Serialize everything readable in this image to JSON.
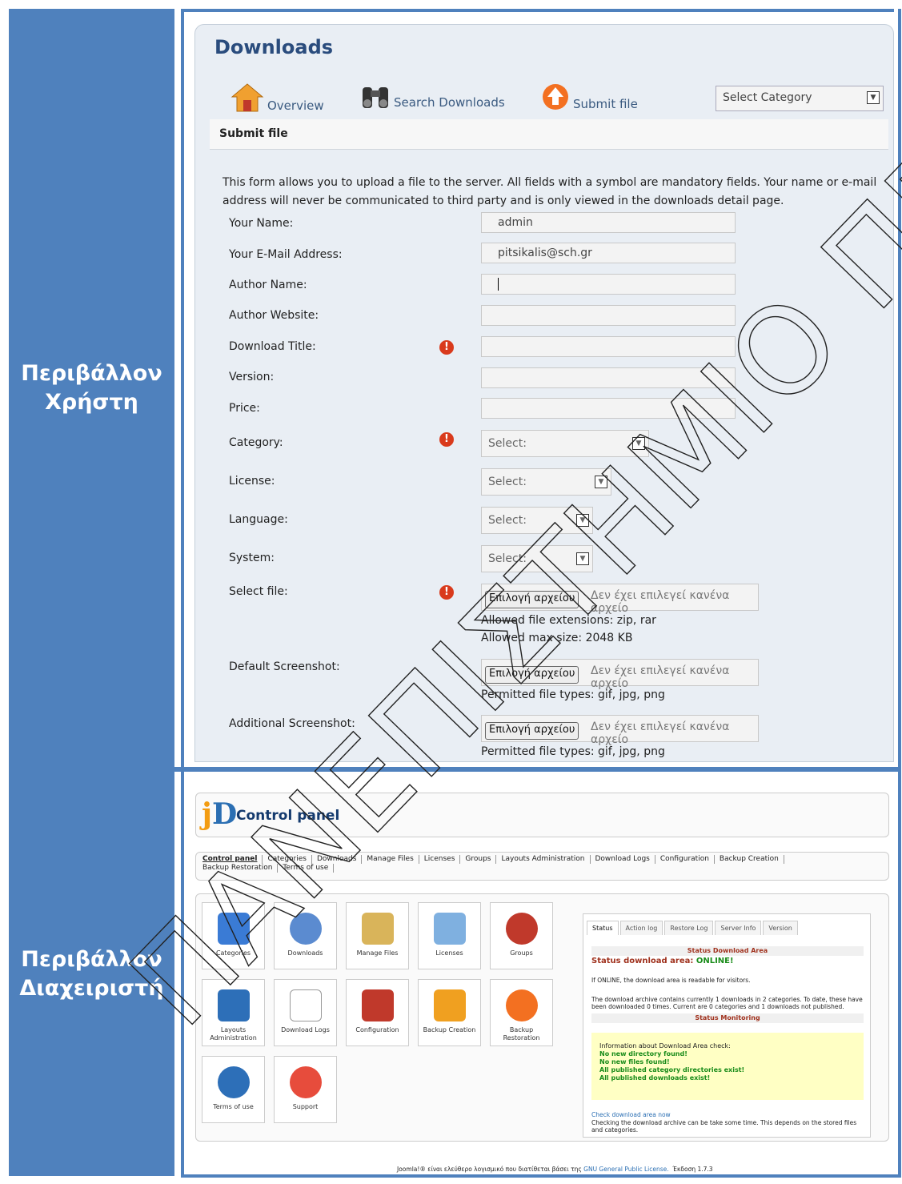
{
  "labels": {
    "user": "Περιβάλλον Χρήστη",
    "user_l1": "Περιβάλλον",
    "user_l2": "Χρήστη",
    "admin_l1": "Περιβάλλον",
    "admin_l2": "Διαχειριστή"
  },
  "user": {
    "title": "Downloads",
    "nav": {
      "overview": "Overview",
      "search": "Search Downloads",
      "submit": "Submit file"
    },
    "category_select": "Select Category",
    "subbar": "Submit file",
    "intro": "This form allows you to upload a file to the server. All fields with a symbol are mandatory fields. Your name or e-mail address will never be communicated to third party and is only viewed in the downloads detail page.",
    "fields": {
      "name_label": "Your Name:",
      "name_value": "admin",
      "email_label": "Your E-Mail Address:",
      "email_value": "pitsikalis@sch.gr",
      "author_label": "Author Name:",
      "website_label": "Author Website:",
      "title_label": "Download Title:",
      "version_label": "Version:",
      "price_label": "Price:",
      "category_label": "Category:",
      "license_label": "License:",
      "language_label": "Language:",
      "system_label": "System:",
      "select_value": "Select:",
      "file_label": "Select file:",
      "default_ss_label": "Default Screenshot:",
      "additional_ss_label": "Additional Screenshot:"
    },
    "file_button": "Επιλογή αρχείου",
    "file_none": "Δεν έχει επιλεγεί κανένα αρχείο",
    "allowed_ext": "Allowed file extensions: zip, rar",
    "allowed_size": "Allowed max size: 2048 KB",
    "permitted": "Permitted file types: gif, jpg, png"
  },
  "admin": {
    "title": "Control panel",
    "menu": [
      "Control panel",
      "Categories",
      "Downloads",
      "Manage Files",
      "Licenses",
      "Groups",
      "Layouts Administration",
      "Download Logs",
      "Configuration",
      "Backup Creation",
      "Backup Restoration",
      "Terms of use"
    ],
    "tiles": [
      "Categories",
      "Downloads",
      "Manage Files",
      "Licenses",
      "Groups",
      "Layouts Administration",
      "Download Logs",
      "Configuration",
      "Backup Creation",
      "Backup Restoration",
      "Terms of use",
      "Support"
    ],
    "tabs": [
      "Status",
      "Action log",
      "Restore Log",
      "Server Info",
      "Version"
    ],
    "status_head": "Status Download Area",
    "status_line": "Status download area:",
    "status_online": "ONLINE!",
    "info1": "If ONLINE, the download area is readable for visitors.",
    "info2": "The download archive contains currently 1 downloads in 2 categories. To date, these have been downloaded 0 times. Current are 0 categories and 1 downloads not published.",
    "monitor_head": "Status Monitoring",
    "monitor_intro": "Information about Download Area check:",
    "monitor": [
      "No new directory found!",
      "No new files found!",
      "All published category directories exist!",
      "All published downloads exist!"
    ],
    "check_link": "Check download area now",
    "check_note": "Checking the download archive can be take some time. This depends on the stored files and categories.",
    "footer_pre": "Joomla!® είναι ελεύθερο λογισμικό που διατίθεται βάσει της",
    "footer_link": "GNU General Public License.",
    "footer_ver": "Έκδοση 1.7.3"
  },
  "watermark": "ΠΑΝΕΠΙΣΤΗΜΙΟ ΠΕΙΡΑΙΩΣ",
  "colors": {
    "frame": "#4f81bd",
    "brand": "#2a4c7d",
    "required": "#d93a1c",
    "online": "#1a8c1a"
  }
}
